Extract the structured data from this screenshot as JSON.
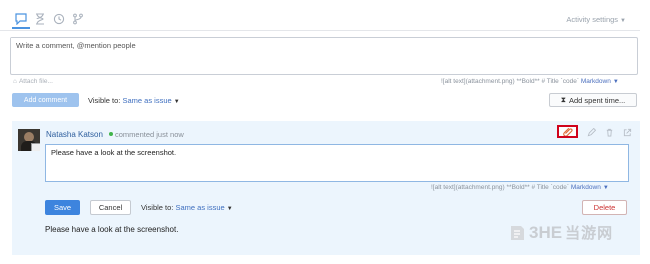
{
  "tabs": [
    {
      "name": "comments",
      "icon": "speech-bubble-icon",
      "active": true
    },
    {
      "name": "time",
      "icon": "hourglass-icon",
      "active": false
    },
    {
      "name": "history",
      "icon": "clock-icon",
      "active": false
    },
    {
      "name": "vcs",
      "icon": "branch-icon",
      "active": false
    }
  ],
  "activity_settings": "Activity settings",
  "new_comment": {
    "placeholder": "Write a comment, @mention people",
    "attach": "Attach file...",
    "markdown_hint": "![alt text](attachment.png) **Bold** # Title `code`",
    "markdown_link": "Markdown",
    "submit": "Add comment",
    "visible_label": "Visible to:",
    "visible_value": "Same as issue",
    "spent_time": "Add spent time..."
  },
  "comment": {
    "author": "Natasha Katson",
    "status": "commented just now",
    "edit_value": "Please have a look at the screenshot.",
    "markdown_hint": "![alt text](attachment.png) **Bold** # Title `code`",
    "markdown_link": "Markdown",
    "save": "Save",
    "cancel": "Cancel",
    "visible_label": "Visible to:",
    "visible_value": "Same as issue",
    "delete": "Delete",
    "text": "Please have a look at the screenshot."
  },
  "watermark": {
    "latin": "3HE",
    "cn": "当游网"
  },
  "colors": {
    "accent": "#3d84de",
    "link": "#2f5f9e",
    "panel_bg": "#ecf5fd",
    "highlight": "#d0021b",
    "online": "#40b44a"
  }
}
